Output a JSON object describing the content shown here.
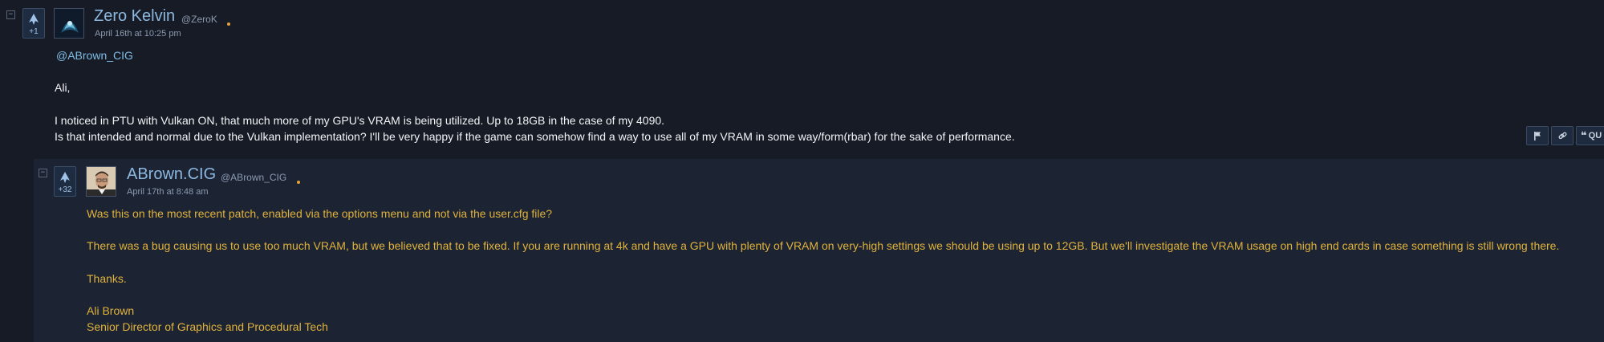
{
  "post": {
    "author": "Zero Kelvin",
    "handle": "@ZeroK",
    "timestamp": "April 16th at 10:25 pm",
    "votes": "+1",
    "mention": "@ABrown_CIG",
    "lines": [
      "Ali,",
      "I noticed in PTU with Vulkan ON, that much more of my GPU's VRAM is being utilized. Up to 18GB in the case of my 4090.",
      "Is that intended and normal due to the Vulkan implementation? I'll be very happy if the game can somehow find a way to use all of my VRAM in some way/form(rbar) for the sake of performance."
    ],
    "actions": {
      "quote_label": "QU"
    }
  },
  "reply": {
    "author": "ABrown.CIG",
    "handle": "@ABrown_CIG",
    "timestamp": "April 17th at 8:48 am",
    "votes": "+32",
    "lines": [
      "Was this on the most recent patch, enabled via the options menu and not via the user.cfg file?",
      "There was a bug causing us to use too much VRAM, but we believed that to be fixed. If you are running at 4k and have a GPU with plenty of VRAM on very-high settings we should be using up to 12GB. But we'll investigate the VRAM usage on high end cards in case something is still wrong there.",
      "Thanks.",
      "Ali Brown",
      "Senior Director of Graphics and Procedural Tech"
    ]
  },
  "colors": {
    "background": "#161b25",
    "reply_background": "#1c2434",
    "username": "#8cb8e0",
    "reply_text": "#e0b23a",
    "mention": "#7fbde7",
    "online_dot": "#e7a13b"
  },
  "icons": {
    "collapse": "minus-box-icon",
    "upvote": "spaceship-upvote-icon",
    "report": "flag-icon",
    "permalink": "link-icon",
    "quote": "quote-icon"
  }
}
